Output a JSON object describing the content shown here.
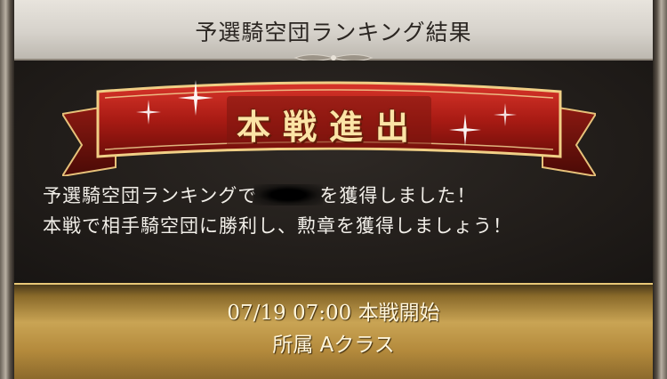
{
  "dialog": {
    "title": "予選騎空団ランキング結果",
    "banner_label": "本戦進出",
    "message_line1_before": "予選騎空団ランキングで",
    "message_line1_after": "を獲得しました！",
    "message_line2": "本戦で相手騎空団に勝利し、勲章を獲得しましょう！",
    "schedule": "07/19 07:00 本戦開始",
    "class_label": "所属 Aクラス"
  },
  "colors": {
    "banner_red": "#b3201a",
    "gold_text": "#fbe4a6",
    "footer_gold": "#c9a454"
  }
}
